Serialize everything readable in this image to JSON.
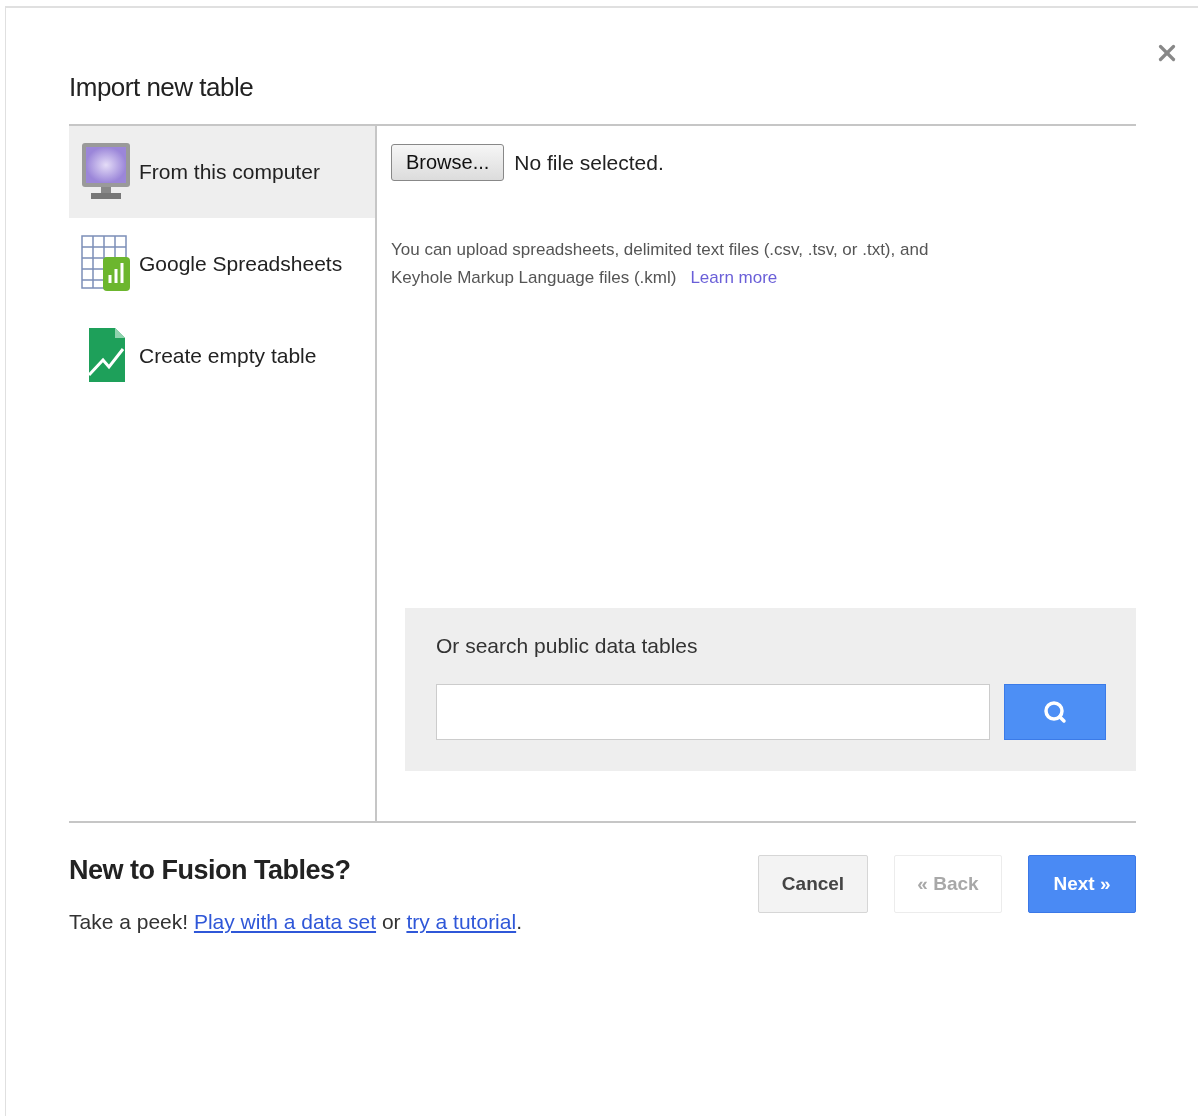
{
  "dialog": {
    "title": "Import new table"
  },
  "sources": [
    {
      "kind": "computer",
      "label": "From this computer",
      "selected": true
    },
    {
      "kind": "spreadsheet",
      "label": "Google Spreadsheets",
      "selected": false
    },
    {
      "kind": "empty",
      "label": "Create empty table",
      "selected": false
    }
  ],
  "upload": {
    "browse_button": "Browse...",
    "file_status": "No file selected.",
    "description": "You can upload spreadsheets, delimited text files (.csv, .tsv, or .txt), and Keyhole Markup Language files (.kml)",
    "learn_more": "Learn more"
  },
  "search": {
    "heading": "Or search public data tables"
  },
  "footer": {
    "heading": "New to Fusion Tables?",
    "intro": "Take a peek!",
    "link_1": "Play with a data set",
    "connector": "or",
    "link_2": "try a tutorial",
    "end": "."
  },
  "buttons": [
    {
      "kind": "plain",
      "label": "Cancel",
      "disabled": false
    },
    {
      "kind": "plain",
      "label": "« Back",
      "disabled": true
    },
    {
      "kind": "primary",
      "label": "Next »",
      "disabled": false
    }
  ]
}
